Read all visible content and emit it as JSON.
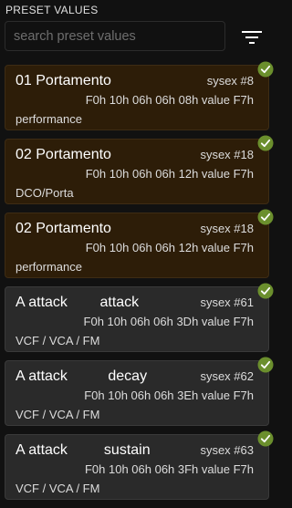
{
  "header": {
    "title": "PRESET VALUES"
  },
  "search": {
    "placeholder": "search preset values",
    "value": ""
  },
  "icons": {
    "filter": "filter-icon",
    "check": "check-circle-icon"
  },
  "colors": {
    "background": "#111111",
    "card_orange": "#2d1d08",
    "card_gray": "#2a2a2a",
    "check_green": "#6b8f2d"
  },
  "items": [
    {
      "name": "01 Portamento",
      "sysex": "sysex #8",
      "bytes": "F0h 10h 06h 06h 08h value F7h",
      "group": "performance",
      "style": "orange",
      "checked": true
    },
    {
      "name": "02 Portamento",
      "sysex": "sysex #18",
      "bytes": "F0h 10h 06h 06h 12h value F7h",
      "group": "DCO/Porta",
      "style": "orange",
      "checked": true
    },
    {
      "name": "02 Portamento",
      "sysex": "sysex #18",
      "bytes": "F0h 10h 06h 06h 12h value F7h",
      "group": "performance",
      "style": "orange",
      "checked": true
    },
    {
      "name": "A attack        attack",
      "sysex": "sysex #61",
      "bytes": "F0h 10h 06h 06h 3Dh value F7h",
      "group": "VCF / VCA / FM",
      "style": "gray",
      "checked": true
    },
    {
      "name": "A attack          decay",
      "sysex": "sysex #62",
      "bytes": "F0h 10h 06h 06h 3Eh value F7h",
      "group": "VCF / VCA / FM",
      "style": "gray",
      "checked": true
    },
    {
      "name": "A attack         sustain",
      "sysex": "sysex #63",
      "bytes": "F0h 10h 06h 06h 3Fh value F7h",
      "group": "VCF / VCA / FM",
      "style": "gray",
      "checked": true
    }
  ]
}
